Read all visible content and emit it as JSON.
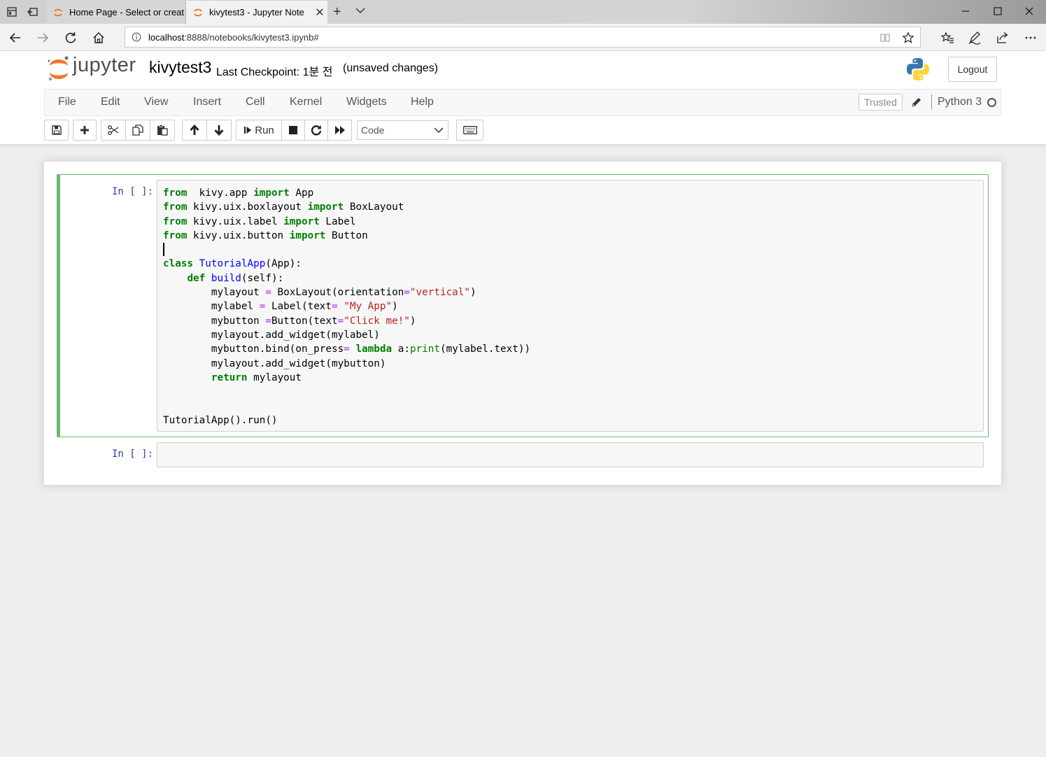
{
  "browser": {
    "tabs": [
      {
        "title": "Home Page - Select or creat",
        "active": false
      },
      {
        "title": "kivytest3 - Jupyter Note",
        "active": true
      }
    ],
    "url": {
      "host": "localhost",
      "rest": ":8888/notebooks/kivytest3.ipynb#"
    }
  },
  "header": {
    "logo_text": "jupyter",
    "notebook_name": "kivytest3",
    "checkpoint": "Last Checkpoint: 1분 전",
    "autosave": "(unsaved changes)",
    "logout_label": "Logout"
  },
  "menubar": {
    "items": [
      "File",
      "Edit",
      "View",
      "Insert",
      "Cell",
      "Kernel",
      "Widgets",
      "Help"
    ],
    "trusted_label": "Trusted",
    "kernel_name": "Python 3"
  },
  "toolbar": {
    "run_label": "Run",
    "cell_type": "Code"
  },
  "cells": [
    {
      "prompt": "In [ ]:",
      "lines": [
        [
          [
            "kw",
            "from"
          ],
          [
            "",
            "  kivy.app "
          ],
          [
            "kw",
            "import"
          ],
          [
            "",
            " App"
          ]
        ],
        [
          [
            "kw",
            "from"
          ],
          [
            "",
            " kivy.uix.boxlayout "
          ],
          [
            "kw",
            "import"
          ],
          [
            "",
            " BoxLayout"
          ]
        ],
        [
          [
            "kw",
            "from"
          ],
          [
            "",
            " kivy.uix.label "
          ],
          [
            "kw",
            "import"
          ],
          [
            "",
            " Label"
          ]
        ],
        [
          [
            "kw",
            "from"
          ],
          [
            "",
            " kivy.uix.button "
          ],
          [
            "kw",
            "import"
          ],
          [
            "",
            " Button"
          ]
        ],
        [],
        [
          [
            "kw",
            "class"
          ],
          [
            "",
            " "
          ],
          [
            "nm",
            "TutorialApp"
          ],
          [
            "",
            "(App):"
          ]
        ],
        [
          [
            "",
            "    "
          ],
          [
            "kw",
            "def"
          ],
          [
            "",
            " "
          ],
          [
            "nm",
            "build"
          ],
          [
            "",
            "(self):"
          ]
        ],
        [
          [
            "",
            "        mylayout "
          ],
          [
            "op",
            "="
          ],
          [
            "",
            " BoxLayout(orientation"
          ],
          [
            "op",
            "="
          ],
          [
            "st",
            "\"vertical\""
          ],
          [
            "",
            ")"
          ]
        ],
        [
          [
            "",
            "        mylabel "
          ],
          [
            "op",
            "="
          ],
          [
            "",
            " Label(text"
          ],
          [
            "op",
            "="
          ],
          [
            "",
            " "
          ],
          [
            "st",
            "\"My App\""
          ],
          [
            "",
            ")"
          ]
        ],
        [
          [
            "",
            "        mybutton "
          ],
          [
            "op",
            "="
          ],
          [
            "",
            "Button(text"
          ],
          [
            "op",
            "="
          ],
          [
            "st",
            "\"Click me!\""
          ],
          [
            "",
            ")"
          ]
        ],
        [
          [
            "",
            "        mylayout.add_widget(mylabel)"
          ]
        ],
        [
          [
            "",
            "        mybutton.bind(on_press"
          ],
          [
            "op",
            "="
          ],
          [
            "",
            " "
          ],
          [
            "kw",
            "lambda"
          ],
          [
            "",
            " a:"
          ],
          [
            "bi",
            "print"
          ],
          [
            "",
            "(mylabel.text))"
          ]
        ],
        [
          [
            "",
            "        mylayout.add_widget(mybutton)"
          ]
        ],
        [
          [
            "",
            "        "
          ],
          [
            "kw",
            "return"
          ],
          [
            "",
            " mylayout"
          ]
        ],
        [],
        [],
        [
          [
            "",
            "TutorialApp().run()"
          ]
        ]
      ]
    },
    {
      "prompt": "In [ ]:",
      "lines": []
    }
  ]
}
